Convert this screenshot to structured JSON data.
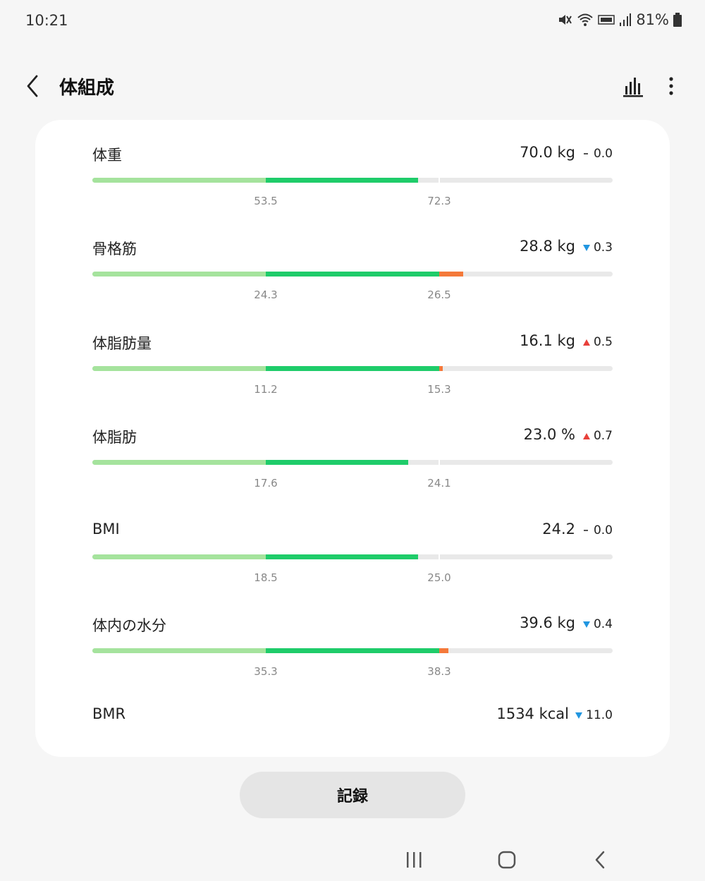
{
  "status": {
    "time": "10:21",
    "battery": "81%"
  },
  "header": {
    "title": "体組成"
  },
  "colors": {
    "light": "#a5e39d",
    "normal": "#1fcc6a",
    "over": "#f4793a",
    "up": "#e8403a",
    "down": "#2196e0"
  },
  "metrics": [
    {
      "label": "体重",
      "value": "70.0 kg",
      "trend": "none",
      "delta": "0.0",
      "low": "53.5",
      "high": "72.3",
      "fill_pct": 62.6,
      "over_pct": 0
    },
    {
      "label": "骨格筋",
      "value": "28.8 kg",
      "trend": "down",
      "delta": "0.3",
      "low": "24.3",
      "high": "26.5",
      "fill_pct": 66.7,
      "over_pct": 66.7
    },
    {
      "label": "体脂肪量",
      "value": "16.1 kg",
      "trend": "up",
      "delta": "0.5",
      "low": "11.2",
      "high": "15.3",
      "fill_pct": 67.0,
      "over_pct": 67.0
    },
    {
      "label": "体脂肪",
      "value": "23.0 %",
      "trend": "up",
      "delta": "0.7",
      "low": "17.6",
      "high": "24.1",
      "fill_pct": 60.7,
      "over_pct": 0
    },
    {
      "label": "BMI",
      "value": "24.2",
      "trend": "none",
      "delta": "0.0",
      "low": "18.5",
      "high": "25.0",
      "fill_pct": 62.6,
      "over_pct": 0
    },
    {
      "label": "体内の水分",
      "value": "39.6 kg",
      "trend": "down",
      "delta": "0.4",
      "low": "35.3",
      "high": "38.3",
      "fill_pct": 68.4,
      "over_pct": 68.4
    }
  ],
  "bmr": {
    "label": "BMR",
    "value": "1534 kcal",
    "trend": "down",
    "delta": "11.0"
  },
  "actions": {
    "record_label": "記録"
  }
}
